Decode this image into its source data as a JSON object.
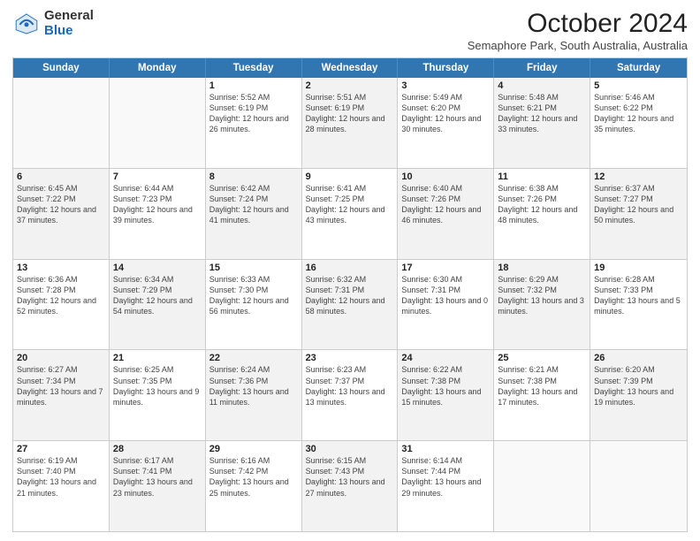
{
  "logo": {
    "general": "General",
    "blue": "Blue"
  },
  "title": {
    "month": "October 2024",
    "location": "Semaphore Park, South Australia, Australia"
  },
  "header_days": [
    "Sunday",
    "Monday",
    "Tuesday",
    "Wednesday",
    "Thursday",
    "Friday",
    "Saturday"
  ],
  "rows": [
    [
      {
        "day": "",
        "info": "",
        "empty": true
      },
      {
        "day": "",
        "info": "",
        "empty": true
      },
      {
        "day": "1",
        "info": "Sunrise: 5:52 AM\nSunset: 6:19 PM\nDaylight: 12 hours and 26 minutes.",
        "shaded": false
      },
      {
        "day": "2",
        "info": "Sunrise: 5:51 AM\nSunset: 6:19 PM\nDaylight: 12 hours and 28 minutes.",
        "shaded": true
      },
      {
        "day": "3",
        "info": "Sunrise: 5:49 AM\nSunset: 6:20 PM\nDaylight: 12 hours and 30 minutes.",
        "shaded": false
      },
      {
        "day": "4",
        "info": "Sunrise: 5:48 AM\nSunset: 6:21 PM\nDaylight: 12 hours and 33 minutes.",
        "shaded": true
      },
      {
        "day": "5",
        "info": "Sunrise: 5:46 AM\nSunset: 6:22 PM\nDaylight: 12 hours and 35 minutes.",
        "shaded": false
      }
    ],
    [
      {
        "day": "6",
        "info": "Sunrise: 6:45 AM\nSunset: 7:22 PM\nDaylight: 12 hours and 37 minutes.",
        "shaded": true
      },
      {
        "day": "7",
        "info": "Sunrise: 6:44 AM\nSunset: 7:23 PM\nDaylight: 12 hours and 39 minutes.",
        "shaded": false
      },
      {
        "day": "8",
        "info": "Sunrise: 6:42 AM\nSunset: 7:24 PM\nDaylight: 12 hours and 41 minutes.",
        "shaded": true
      },
      {
        "day": "9",
        "info": "Sunrise: 6:41 AM\nSunset: 7:25 PM\nDaylight: 12 hours and 43 minutes.",
        "shaded": false
      },
      {
        "day": "10",
        "info": "Sunrise: 6:40 AM\nSunset: 7:26 PM\nDaylight: 12 hours and 46 minutes.",
        "shaded": true
      },
      {
        "day": "11",
        "info": "Sunrise: 6:38 AM\nSunset: 7:26 PM\nDaylight: 12 hours and 48 minutes.",
        "shaded": false
      },
      {
        "day": "12",
        "info": "Sunrise: 6:37 AM\nSunset: 7:27 PM\nDaylight: 12 hours and 50 minutes.",
        "shaded": true
      }
    ],
    [
      {
        "day": "13",
        "info": "Sunrise: 6:36 AM\nSunset: 7:28 PM\nDaylight: 12 hours and 52 minutes.",
        "shaded": false
      },
      {
        "day": "14",
        "info": "Sunrise: 6:34 AM\nSunset: 7:29 PM\nDaylight: 12 hours and 54 minutes.",
        "shaded": true
      },
      {
        "day": "15",
        "info": "Sunrise: 6:33 AM\nSunset: 7:30 PM\nDaylight: 12 hours and 56 minutes.",
        "shaded": false
      },
      {
        "day": "16",
        "info": "Sunrise: 6:32 AM\nSunset: 7:31 PM\nDaylight: 12 hours and 58 minutes.",
        "shaded": true
      },
      {
        "day": "17",
        "info": "Sunrise: 6:30 AM\nSunset: 7:31 PM\nDaylight: 13 hours and 0 minutes.",
        "shaded": false
      },
      {
        "day": "18",
        "info": "Sunrise: 6:29 AM\nSunset: 7:32 PM\nDaylight: 13 hours and 3 minutes.",
        "shaded": true
      },
      {
        "day": "19",
        "info": "Sunrise: 6:28 AM\nSunset: 7:33 PM\nDaylight: 13 hours and 5 minutes.",
        "shaded": false
      }
    ],
    [
      {
        "day": "20",
        "info": "Sunrise: 6:27 AM\nSunset: 7:34 PM\nDaylight: 13 hours and 7 minutes.",
        "shaded": true
      },
      {
        "day": "21",
        "info": "Sunrise: 6:25 AM\nSunset: 7:35 PM\nDaylight: 13 hours and 9 minutes.",
        "shaded": false
      },
      {
        "day": "22",
        "info": "Sunrise: 6:24 AM\nSunset: 7:36 PM\nDaylight: 13 hours and 11 minutes.",
        "shaded": true
      },
      {
        "day": "23",
        "info": "Sunrise: 6:23 AM\nSunset: 7:37 PM\nDaylight: 13 hours and 13 minutes.",
        "shaded": false
      },
      {
        "day": "24",
        "info": "Sunrise: 6:22 AM\nSunset: 7:38 PM\nDaylight: 13 hours and 15 minutes.",
        "shaded": true
      },
      {
        "day": "25",
        "info": "Sunrise: 6:21 AM\nSunset: 7:38 PM\nDaylight: 13 hours and 17 minutes.",
        "shaded": false
      },
      {
        "day": "26",
        "info": "Sunrise: 6:20 AM\nSunset: 7:39 PM\nDaylight: 13 hours and 19 minutes.",
        "shaded": true
      }
    ],
    [
      {
        "day": "27",
        "info": "Sunrise: 6:19 AM\nSunset: 7:40 PM\nDaylight: 13 hours and 21 minutes.",
        "shaded": false
      },
      {
        "day": "28",
        "info": "Sunrise: 6:17 AM\nSunset: 7:41 PM\nDaylight: 13 hours and 23 minutes.",
        "shaded": true
      },
      {
        "day": "29",
        "info": "Sunrise: 6:16 AM\nSunset: 7:42 PM\nDaylight: 13 hours and 25 minutes.",
        "shaded": false
      },
      {
        "day": "30",
        "info": "Sunrise: 6:15 AM\nSunset: 7:43 PM\nDaylight: 13 hours and 27 minutes.",
        "shaded": true
      },
      {
        "day": "31",
        "info": "Sunrise: 6:14 AM\nSunset: 7:44 PM\nDaylight: 13 hours and 29 minutes.",
        "shaded": false
      },
      {
        "day": "",
        "info": "",
        "empty": true
      },
      {
        "day": "",
        "info": "",
        "empty": true
      }
    ]
  ]
}
